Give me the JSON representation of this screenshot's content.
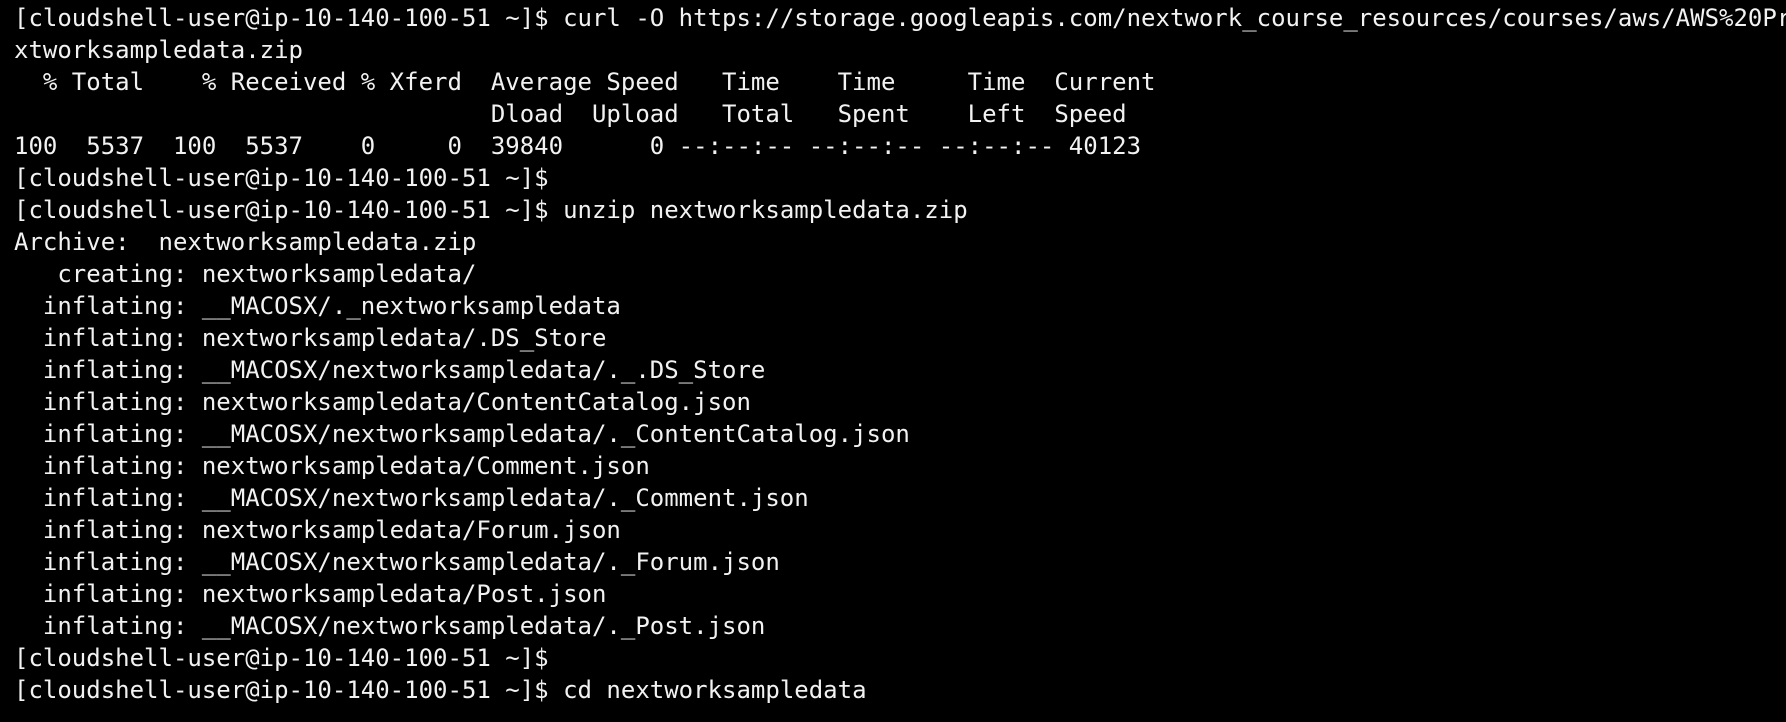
{
  "terminal": {
    "lines": [
      {
        "prompt": "[cloudshell-user@ip-10-140-100-51 ~]$ ",
        "text": "curl -O https://storage.googleapis.com/nextwork_course_resources/courses/aws/AWS%20Pr"
      },
      {
        "prompt": "",
        "text": "xtworksampledata.zip"
      },
      {
        "prompt": "",
        "text": "  % Total    % Received % Xferd  Average Speed   Time    Time     Time  Current"
      },
      {
        "prompt": "",
        "text": "                                 Dload  Upload   Total   Spent    Left  Speed"
      },
      {
        "prompt": "",
        "text": "100  5537  100  5537    0     0  39840      0 --:--:-- --:--:-- --:--:-- 40123"
      },
      {
        "prompt": "[cloudshell-user@ip-10-140-100-51 ~]$",
        "text": ""
      },
      {
        "prompt": "[cloudshell-user@ip-10-140-100-51 ~]$ ",
        "text": "unzip nextworksampledata.zip"
      },
      {
        "prompt": "",
        "text": "Archive:  nextworksampledata.zip"
      },
      {
        "prompt": "",
        "text": "   creating: nextworksampledata/"
      },
      {
        "prompt": "",
        "text": "  inflating: __MACOSX/._nextworksampledata"
      },
      {
        "prompt": "",
        "text": "  inflating: nextworksampledata/.DS_Store"
      },
      {
        "prompt": "",
        "text": "  inflating: __MACOSX/nextworksampledata/._.DS_Store"
      },
      {
        "prompt": "",
        "text": "  inflating: nextworksampledata/ContentCatalog.json"
      },
      {
        "prompt": "",
        "text": "  inflating: __MACOSX/nextworksampledata/._ContentCatalog.json"
      },
      {
        "prompt": "",
        "text": "  inflating: nextworksampledata/Comment.json"
      },
      {
        "prompt": "",
        "text": "  inflating: __MACOSX/nextworksampledata/._Comment.json"
      },
      {
        "prompt": "",
        "text": "  inflating: nextworksampledata/Forum.json"
      },
      {
        "prompt": "",
        "text": "  inflating: __MACOSX/nextworksampledata/._Forum.json"
      },
      {
        "prompt": "",
        "text": "  inflating: nextworksampledata/Post.json"
      },
      {
        "prompt": "",
        "text": "  inflating: __MACOSX/nextworksampledata/._Post.json"
      },
      {
        "prompt": "[cloudshell-user@ip-10-140-100-51 ~]$",
        "text": ""
      },
      {
        "prompt": "[cloudshell-user@ip-10-140-100-51 ~]$ ",
        "text": "cd nextworksampledata"
      }
    ]
  },
  "colors": {
    "background": "#000000",
    "foreground": "#f2f2f2"
  }
}
